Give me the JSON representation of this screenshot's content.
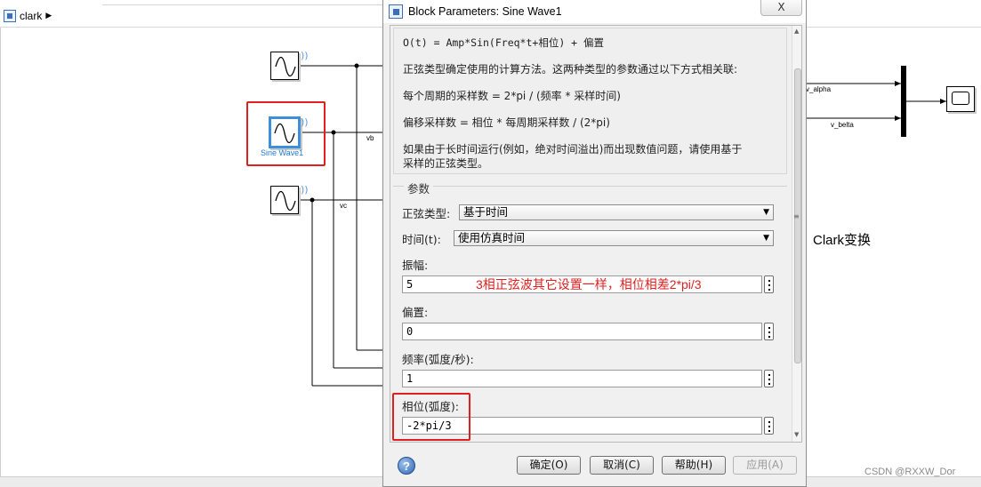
{
  "simulink": {
    "model_name": "clark",
    "blocks": {
      "sine_selected_label": "Sine Wave1"
    },
    "signals": {
      "vb": "vb",
      "vc": "vc",
      "v_alpha": "v_alpha",
      "v_belta": "v_belta"
    },
    "annotation": "Clark变换"
  },
  "dialog": {
    "title": "Block Parameters: Sine Wave1",
    "close_label": "X",
    "description": {
      "formula": "O(t) = Amp*Sin(Freq*t+相位) + 偏置",
      "line1": "正弦类型确定使用的计算方法。这两种类型的参数通过以下方式相关联:",
      "line2": "每个周期的采样数 = 2*pi / (频率 * 采样时间)",
      "line3": "偏移采样数 = 相位 * 每周期采样数 / (2*pi)",
      "line4a": "如果由于长时间运行(例如，绝对时间溢出)而出现数值问题，请使用基于",
      "line4b": "采样的正弦类型。"
    },
    "params_group_title": "参数",
    "sine_type": {
      "label": "正弦类型:",
      "value": "基于时间"
    },
    "time": {
      "label": "时间(t):",
      "value": "使用仿真时间"
    },
    "amplitude": {
      "label": "振幅:",
      "value": "5"
    },
    "bias": {
      "label": "偏置:",
      "value": "0"
    },
    "frequency": {
      "label": "频率(弧度/秒):",
      "value": "1"
    },
    "phase": {
      "label": "相位(弧度):",
      "value": "-2*pi/3"
    },
    "red_note": "3相正弦波其它设置一样，相位相差2*pi/3",
    "buttons": {
      "help": "?",
      "ok": "确定(O)",
      "cancel": "取消(C)",
      "help_btn": "帮助(H)",
      "apply": "应用(A)"
    }
  },
  "watermark": "CSDN @RXXW_Dor",
  "colors": {
    "annotation_red": "#e02020",
    "selection_blue": "#3d8fd9",
    "label_blue": "#1f79d1"
  }
}
